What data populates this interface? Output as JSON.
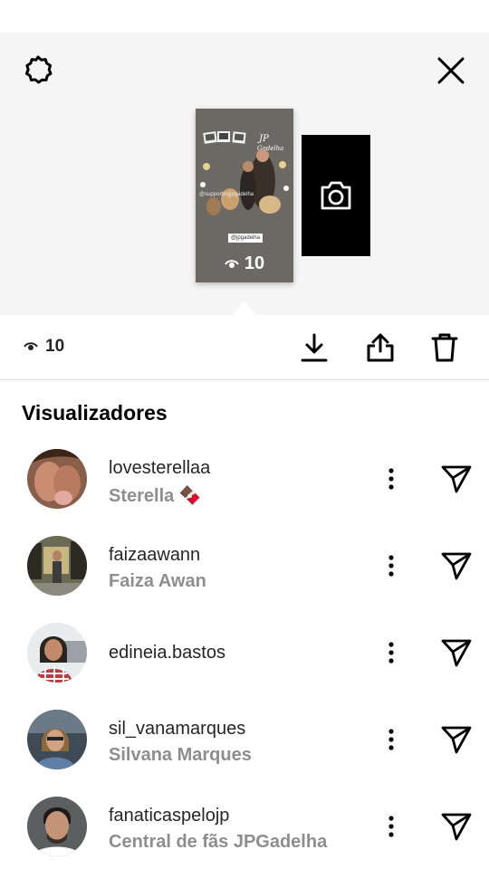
{
  "story": {
    "views": "10",
    "caption": "@supportingjpgadelha",
    "tag": "@jpgadelha",
    "title": "JP Gadelha"
  },
  "summary": {
    "views": "10"
  },
  "icons": {
    "settings": "settings-gear-icon",
    "close": "close-x-icon",
    "eye": "eye-icon",
    "camera": "camera-icon",
    "download": "download-icon",
    "share": "share-icon",
    "delete": "trash-icon",
    "more": "more-vertical-icon",
    "send": "send-paper-plane-icon"
  },
  "section": {
    "title": "Visualizadores"
  },
  "viewers": [
    {
      "username": "lovesterellaa",
      "fullname": "Sterella 🍫"
    },
    {
      "username": "faizaawann",
      "fullname": "Faiza Awan"
    },
    {
      "username": "edineia.bastos",
      "fullname": ""
    },
    {
      "username": "sil_vanamarques",
      "fullname": "Silvana Marques"
    },
    {
      "username": "fanaticaspelojp",
      "fullname": "Central de fãs JPGadelha"
    }
  ],
  "colors": {
    "preview_bg": "#f5f5f5",
    "divider": "#dbdbdb",
    "secondary_text": "#8e8e8e",
    "primary_text": "#262626"
  }
}
